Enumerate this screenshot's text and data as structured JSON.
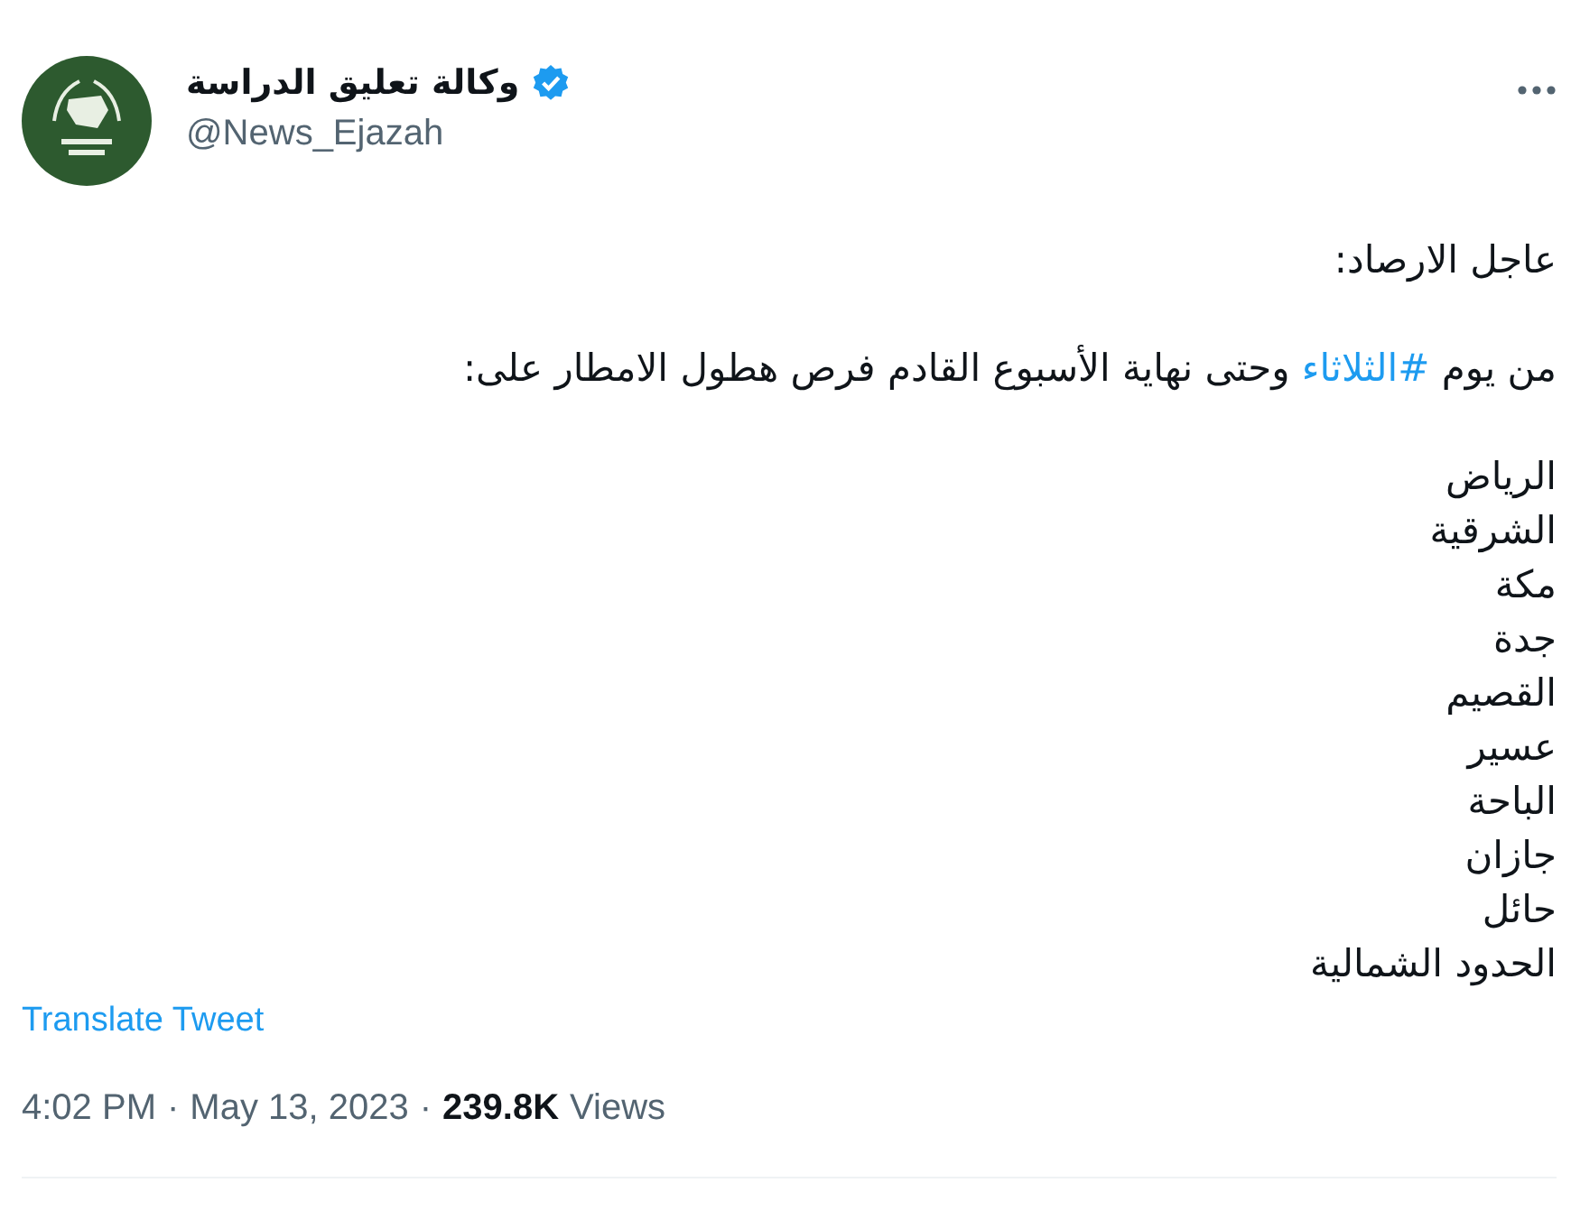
{
  "author": {
    "name": "وكالة تعليق الدراسة",
    "verified": true,
    "handle": "@News_Ejazah"
  },
  "tweet": {
    "headline": "عاجل الارصاد:",
    "intro": {
      "before": "من يوم ",
      "hashtag": "#الثلاثاء",
      "after": " وحتى نهاية الأسبوع القادم فرص هطول الامطار على:"
    },
    "places": [
      "الرياض",
      "الشرقية",
      "مكة",
      "جدة",
      "القصيم",
      "عسير",
      "الباحة",
      "جازان",
      "حائل",
      "الحدود الشمالية"
    ]
  },
  "translate_link": "Translate Tweet",
  "meta": {
    "time": "4:02 PM",
    "separator": "·",
    "date": "May 13, 2023",
    "views_count": "239.8K",
    "views_label": "Views"
  }
}
